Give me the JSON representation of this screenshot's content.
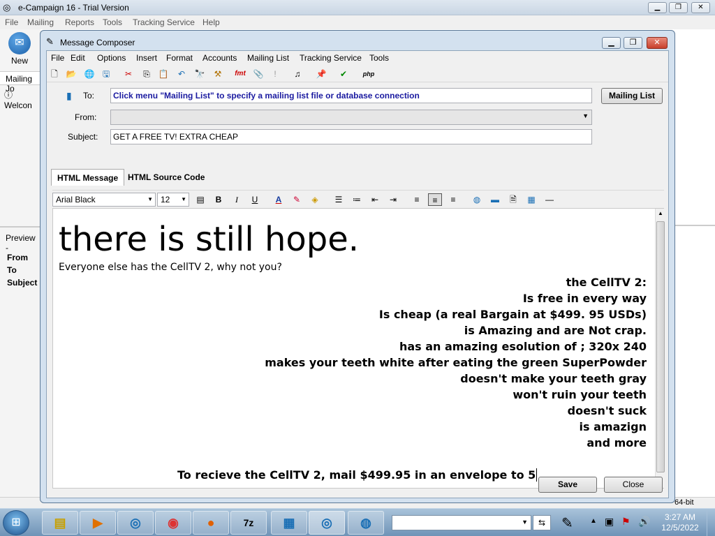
{
  "main_window": {
    "title": "e-Campaign 16 - Trial Version",
    "menu": [
      "File",
      "Mailing",
      "Reports",
      "Tools",
      "Tracking Service",
      "Help"
    ],
    "new_label": "New",
    "left_labels": [
      "Mailing Jo",
      "Welcon",
      "Preview -"
    ],
    "preview_labels": [
      "From",
      "To",
      "Subject"
    ],
    "status_right": "64-bit"
  },
  "dialog": {
    "title": "Message Composer",
    "menu": [
      "File",
      "Edit",
      "Options",
      "Insert",
      "Format",
      "Accounts",
      "Mailing List",
      "Tracking Service",
      "Tools"
    ],
    "to_label": "To:",
    "to_value": "Click menu \"Mailing List\" to specify a mailing list file or database connection",
    "mailing_list_button": "Mailing List",
    "from_label": "From:",
    "from_value": "",
    "subject_label": "Subject:",
    "subject_value": "GET A FREE TV! EXTRA CHEAP",
    "tabs": [
      "HTML Message",
      "HTML Source Code"
    ],
    "font_family": "Arial Black",
    "font_size": "12",
    "save_button": "Save",
    "close_button": "Close"
  },
  "message": {
    "headline": "there is still hope.",
    "subline": "Everyone else has the CellTV 2, why not you?",
    "lines": [
      "the CellTV 2:",
      "Is free in every way",
      "Is cheap (a real Bargain at $499. 95 USDs)",
      "is Amazing and are Not crap.",
      "has an amazing esolution of ; 320x 240",
      "makes your teeth white after eating the green SuperPowder",
      "doesn't make your teeth gray",
      "won't ruin your teeth",
      "doesn't suck",
      "is amazign",
      "and more"
    ],
    "closing": "To recieve the CellTV 2, mail $499.95 in an envelope to 5"
  },
  "taskbar": {
    "time": "3:27 AM",
    "date": "12/5/2022",
    "search_value": ""
  },
  "colors": {
    "to_text": "#1a1aa0"
  }
}
